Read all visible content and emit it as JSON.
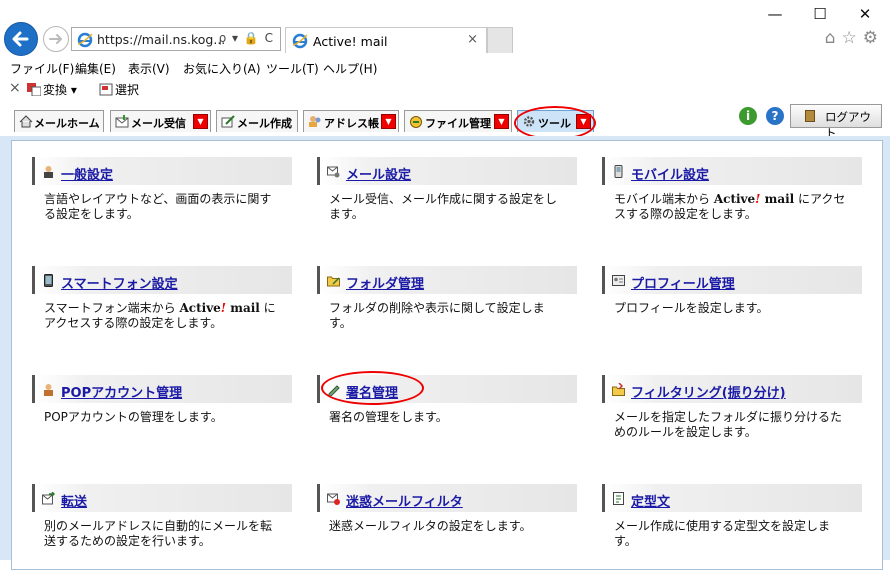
{
  "browser": {
    "address_url": "https://mail.ns.kog...",
    "address_tools": "ρ ▾ 🔒 C",
    "tab_title": "Active! mail",
    "tab_close": "×",
    "win_minimize": "—",
    "win_maximize": "☐",
    "win_close": "✕",
    "menu": [
      "ファイル(F)",
      "編集(E)",
      "表示(V)",
      "お気に入り(A)",
      "ツール(T)",
      "ヘルプ(H)"
    ],
    "cmd": {
      "close": "×",
      "translate": "変換",
      "select": "選択"
    }
  },
  "toolbar": {
    "tabs": [
      {
        "label": "メールホーム"
      },
      {
        "label": "メール受信"
      },
      {
        "label": "メール作成"
      },
      {
        "label": "アドレス帳"
      },
      {
        "label": "ファイル管理"
      },
      {
        "label": "ツール"
      }
    ],
    "dropdown_glyph": "▼",
    "info": "i",
    "help": "?",
    "logout": "ログアウト"
  },
  "items": [
    {
      "title": "一般設定",
      "desc": "言語やレイアウトなど、画面の表示に関する設定をします。"
    },
    {
      "title": "メール設定",
      "desc": "メール受信、メール作成に関する設定をします。"
    },
    {
      "title": "モバイル設定",
      "desc_pre": "モバイル端末から ",
      "brand": "Active",
      "brand_mark": "!",
      "brand_post": " mail",
      "desc_post": " にアクセスする際の設定をします。"
    },
    {
      "title": "スマートフォン設定",
      "desc_pre": "スマートフォン端末から ",
      "brand": "Active",
      "brand_mark": "!",
      "brand_post": " mail",
      "desc_post": " にアクセスする際の設定をします。"
    },
    {
      "title": "フォルダ管理",
      "desc": "フォルダの削除や表示に関して設定します。"
    },
    {
      "title": "プロフィール管理",
      "desc": "プロフィールを設定します。"
    },
    {
      "title": "POPアカウント管理",
      "desc": "POPアカウントの管理をします。"
    },
    {
      "title": "署名管理",
      "desc": "署名の管理をします。"
    },
    {
      "title": "フィルタリング(振り分け)",
      "desc": "メールを指定したフォルダに振り分けるためのルールを設定します。"
    },
    {
      "title": "転送",
      "desc": "別のメールアドレスに自動的にメールを転送するための設定を行います。"
    },
    {
      "title": "迷惑メールフィルタ",
      "desc": "迷惑メールフィルタの設定をします。"
    },
    {
      "title": "定型文",
      "desc": "メール作成に使用する定型文を設定します。"
    }
  ]
}
